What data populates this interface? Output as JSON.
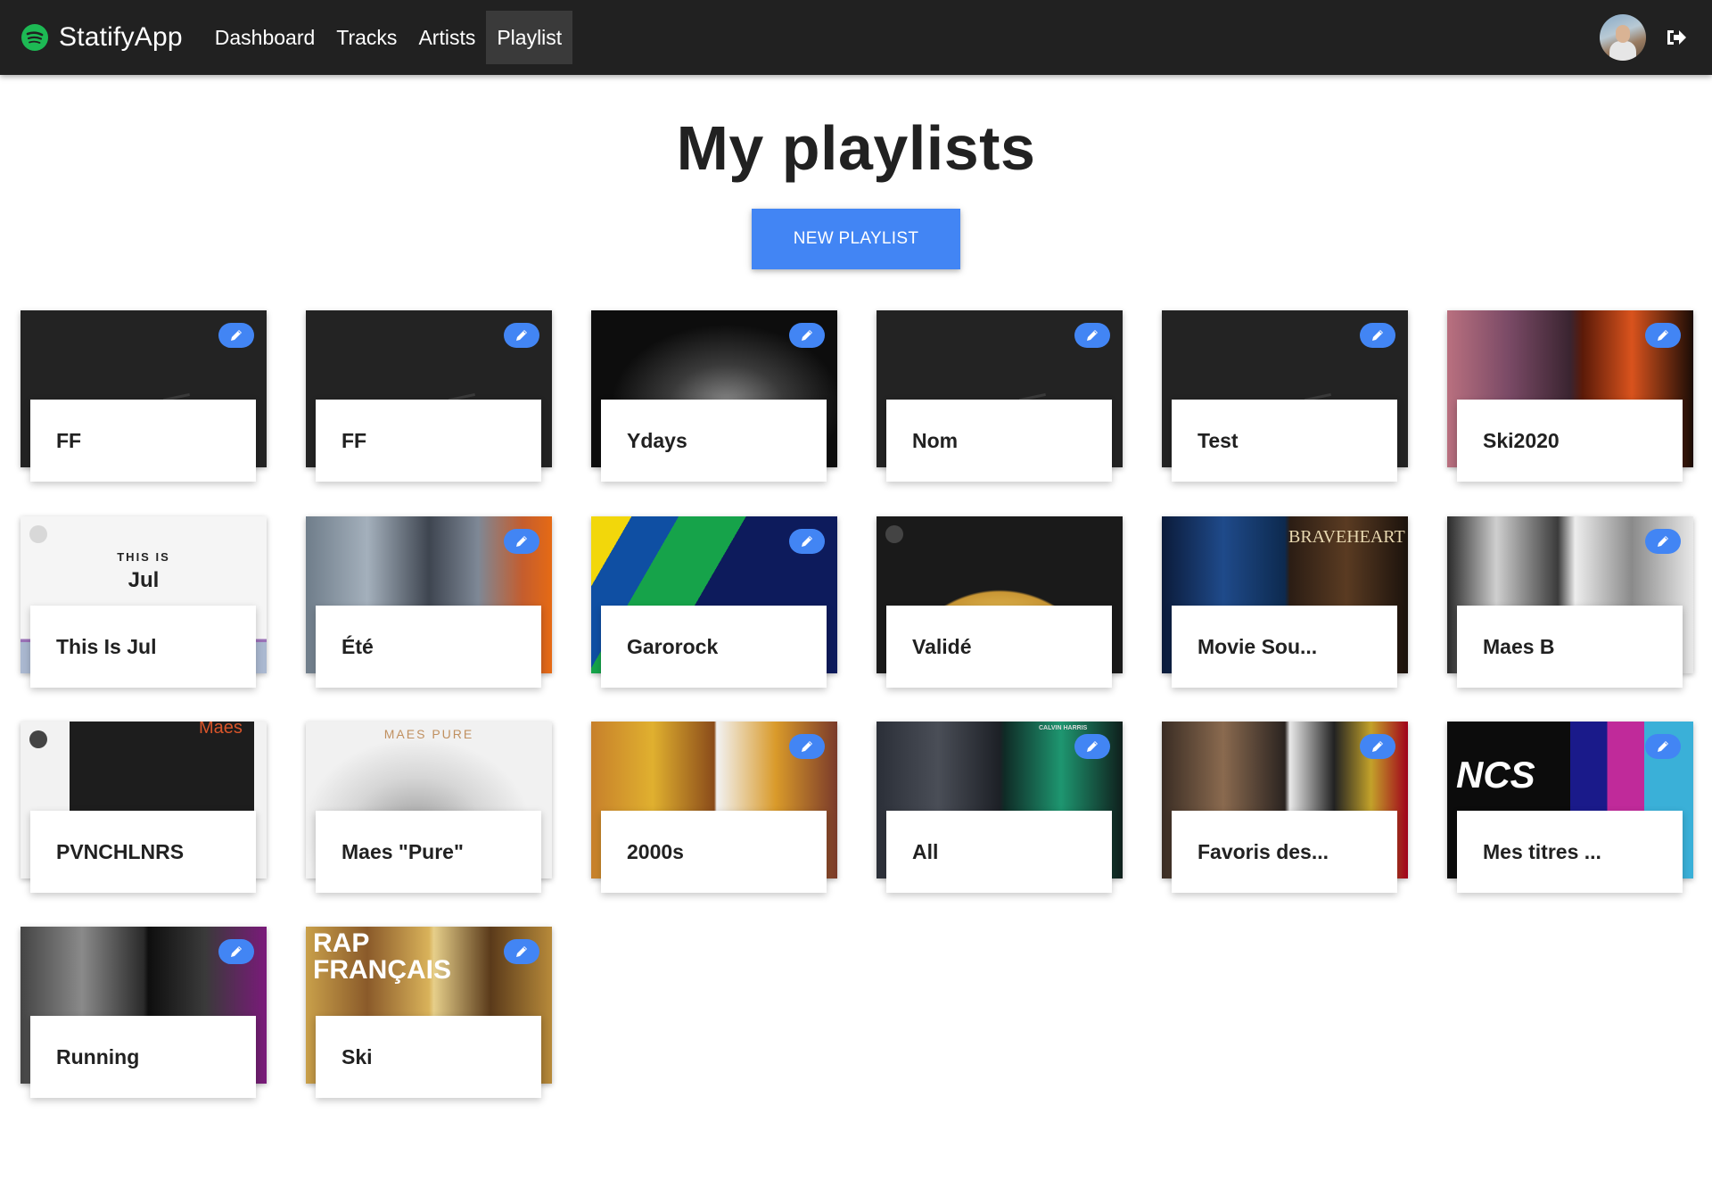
{
  "app": {
    "brand": "StatifyApp",
    "nav": [
      {
        "label": "Dashboard",
        "active": false
      },
      {
        "label": "Tracks",
        "active": false
      },
      {
        "label": "Artists",
        "active": false
      },
      {
        "label": "Playlist",
        "active": true
      }
    ],
    "logout_icon": "sign-out-icon",
    "accent": "#4285f4",
    "navbar_bg": "#212121",
    "spotify_green": "#1DB954"
  },
  "main": {
    "title": "My playlists",
    "new_button": "NEW PLAYLIST"
  },
  "playlists": [
    {
      "name": "FF",
      "editable": true,
      "cover": "dark"
    },
    {
      "name": "FF",
      "editable": true,
      "cover": "dark"
    },
    {
      "name": "Ydays",
      "editable": true,
      "cover": "ydays"
    },
    {
      "name": "Nom",
      "editable": true,
      "cover": "dark"
    },
    {
      "name": "Test",
      "editable": true,
      "cover": "dark"
    },
    {
      "name": "Ski2020",
      "editable": true,
      "cover": "ski2020"
    },
    {
      "name": "This Is Jul",
      "editable": false,
      "cover": "jul",
      "cover_text_top": "THIS IS",
      "cover_text_main": "Jul"
    },
    {
      "name": "Été",
      "editable": true,
      "cover": "ete"
    },
    {
      "name": "Garorock",
      "editable": true,
      "cover": "garorock"
    },
    {
      "name": "Validé",
      "editable": false,
      "cover": "valide"
    },
    {
      "name": "Movie Sou...",
      "editable": false,
      "cover": "movie",
      "cover_text_main": "BRAVEHEART"
    },
    {
      "name": "Maes B",
      "editable": true,
      "cover": "maesb"
    },
    {
      "name": "PVNCHLNRS",
      "editable": false,
      "cover": "pvnch",
      "cover_text_main": "Maes"
    },
    {
      "name": "Maes \"Pure\"",
      "editable": false,
      "cover": "pure",
      "cover_text_main": "MAES PURE"
    },
    {
      "name": "2000s",
      "editable": true,
      "cover": "2000s"
    },
    {
      "name": "All",
      "editable": true,
      "cover": "all",
      "cover_text_main": "CALVIN HARRIS"
    },
    {
      "name": "Favoris des...",
      "editable": true,
      "cover": "favoris"
    },
    {
      "name": "Mes titres ...",
      "editable": true,
      "cover": "ncs",
      "cover_text_main": "NCS"
    },
    {
      "name": "Running",
      "editable": true,
      "cover": "running"
    },
    {
      "name": "Ski",
      "editable": true,
      "cover": "ski",
      "cover_text_main": "RAP FRANÇAIS"
    }
  ]
}
